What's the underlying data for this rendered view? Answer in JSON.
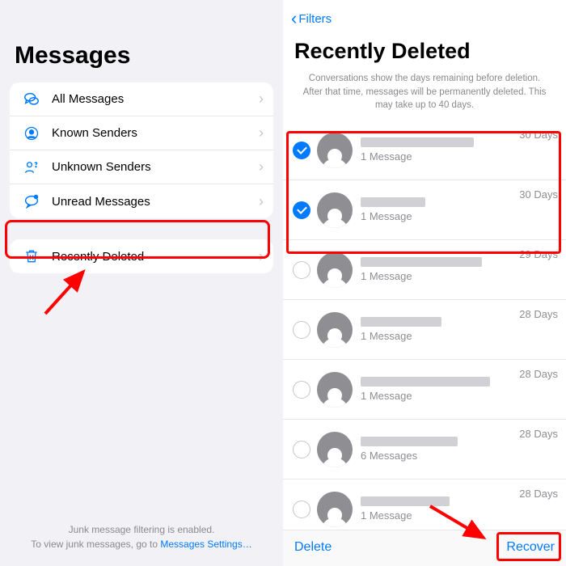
{
  "left": {
    "title": "Messages",
    "filters": [
      {
        "label": "All Messages",
        "icon": "chat-bubbles"
      },
      {
        "label": "Known Senders",
        "icon": "person-circle"
      },
      {
        "label": "Unknown Senders",
        "icon": "person-question"
      },
      {
        "label": "Unread Messages",
        "icon": "chat-dot"
      }
    ],
    "recently_deleted": {
      "label": "Recently Deleted",
      "icon": "trash"
    },
    "footer_line1": "Junk message filtering is enabled.",
    "footer_line2_a": "To view junk messages, go to ",
    "footer_link": "Messages Settings…"
  },
  "right": {
    "back_label": "Filters",
    "title": "Recently Deleted",
    "subtitle": "Conversations show the days remaining before deletion. After that time, messages will be permanently deleted. This may take up to 40 days.",
    "conversations": [
      {
        "selected": true,
        "name_w": 140,
        "count": "1 Message",
        "days": "30 Days"
      },
      {
        "selected": true,
        "name_w": 80,
        "count": "1 Message",
        "days": "30 Days"
      },
      {
        "selected": false,
        "name_w": 150,
        "count": "1 Message",
        "days": "29 Days"
      },
      {
        "selected": false,
        "name_w": 100,
        "count": "1 Message",
        "days": "28 Days"
      },
      {
        "selected": false,
        "name_w": 160,
        "count": "1 Message",
        "days": "28 Days"
      },
      {
        "selected": false,
        "name_w": 120,
        "count": "6 Messages",
        "days": "28 Days"
      },
      {
        "selected": false,
        "name_w": 110,
        "count": "1 Message",
        "days": "28 Days"
      }
    ],
    "delete_label": "Delete",
    "recover_label": "Recover"
  },
  "colors": {
    "accent": "#007aff",
    "highlight": "#ff0000"
  }
}
